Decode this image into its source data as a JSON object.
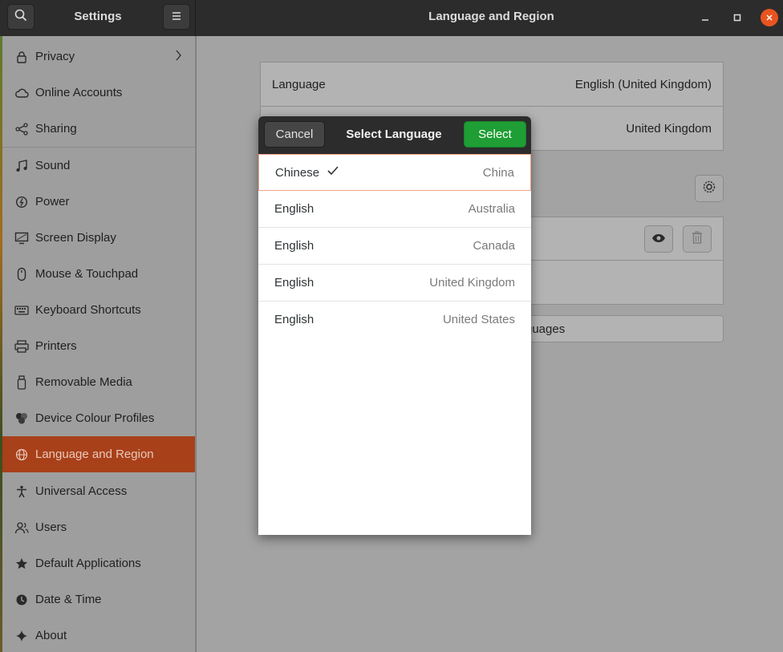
{
  "header": {
    "app_title": "Settings",
    "page_title": "Language and Region"
  },
  "sidebar": {
    "items": [
      {
        "label": "Privacy",
        "icon": "lock-icon"
      },
      {
        "label": "Online Accounts",
        "icon": "cloud-icon"
      },
      {
        "label": "Sharing",
        "icon": "share-icon"
      },
      {
        "label": "Sound",
        "icon": "music-note-icon"
      },
      {
        "label": "Power",
        "icon": "power-icon"
      },
      {
        "label": "Screen Display",
        "icon": "display-icon"
      },
      {
        "label": "Mouse & Touchpad",
        "icon": "mouse-icon"
      },
      {
        "label": "Keyboard Shortcuts",
        "icon": "keyboard-icon"
      },
      {
        "label": "Printers",
        "icon": "printer-icon"
      },
      {
        "label": "Removable Media",
        "icon": "usb-icon"
      },
      {
        "label": "Device Colour Profiles",
        "icon": "color-profile-icon"
      },
      {
        "label": "Language and Region",
        "icon": "globe-icon",
        "active": true
      },
      {
        "label": "Universal Access",
        "icon": "accessibility-icon"
      },
      {
        "label": "Users",
        "icon": "users-icon"
      },
      {
        "label": "Default Applications",
        "icon": "star-icon"
      },
      {
        "label": "Date & Time",
        "icon": "clock-icon"
      },
      {
        "label": "About",
        "icon": "sparkle-icon"
      }
    ]
  },
  "main": {
    "language_label": "Language",
    "language_value": "English (United Kingdom)",
    "formats_value": "United Kingdom",
    "manage_languages_partial": "guages"
  },
  "dialog": {
    "cancel_label": "Cancel",
    "title": "Select Language",
    "select_label": "Select",
    "languages": [
      {
        "name": "Chinese",
        "region": "China",
        "selected": true
      },
      {
        "name": "English",
        "region": "Australia"
      },
      {
        "name": "English",
        "region": "Canada"
      },
      {
        "name": "English",
        "region": "United Kingdom"
      },
      {
        "name": "English",
        "region": "United States"
      }
    ]
  },
  "colors": {
    "accent": "#e95420",
    "active_sidebar": "#a8401a",
    "select_button": "#1f9e35",
    "headerbar": "#2c2c2c"
  }
}
